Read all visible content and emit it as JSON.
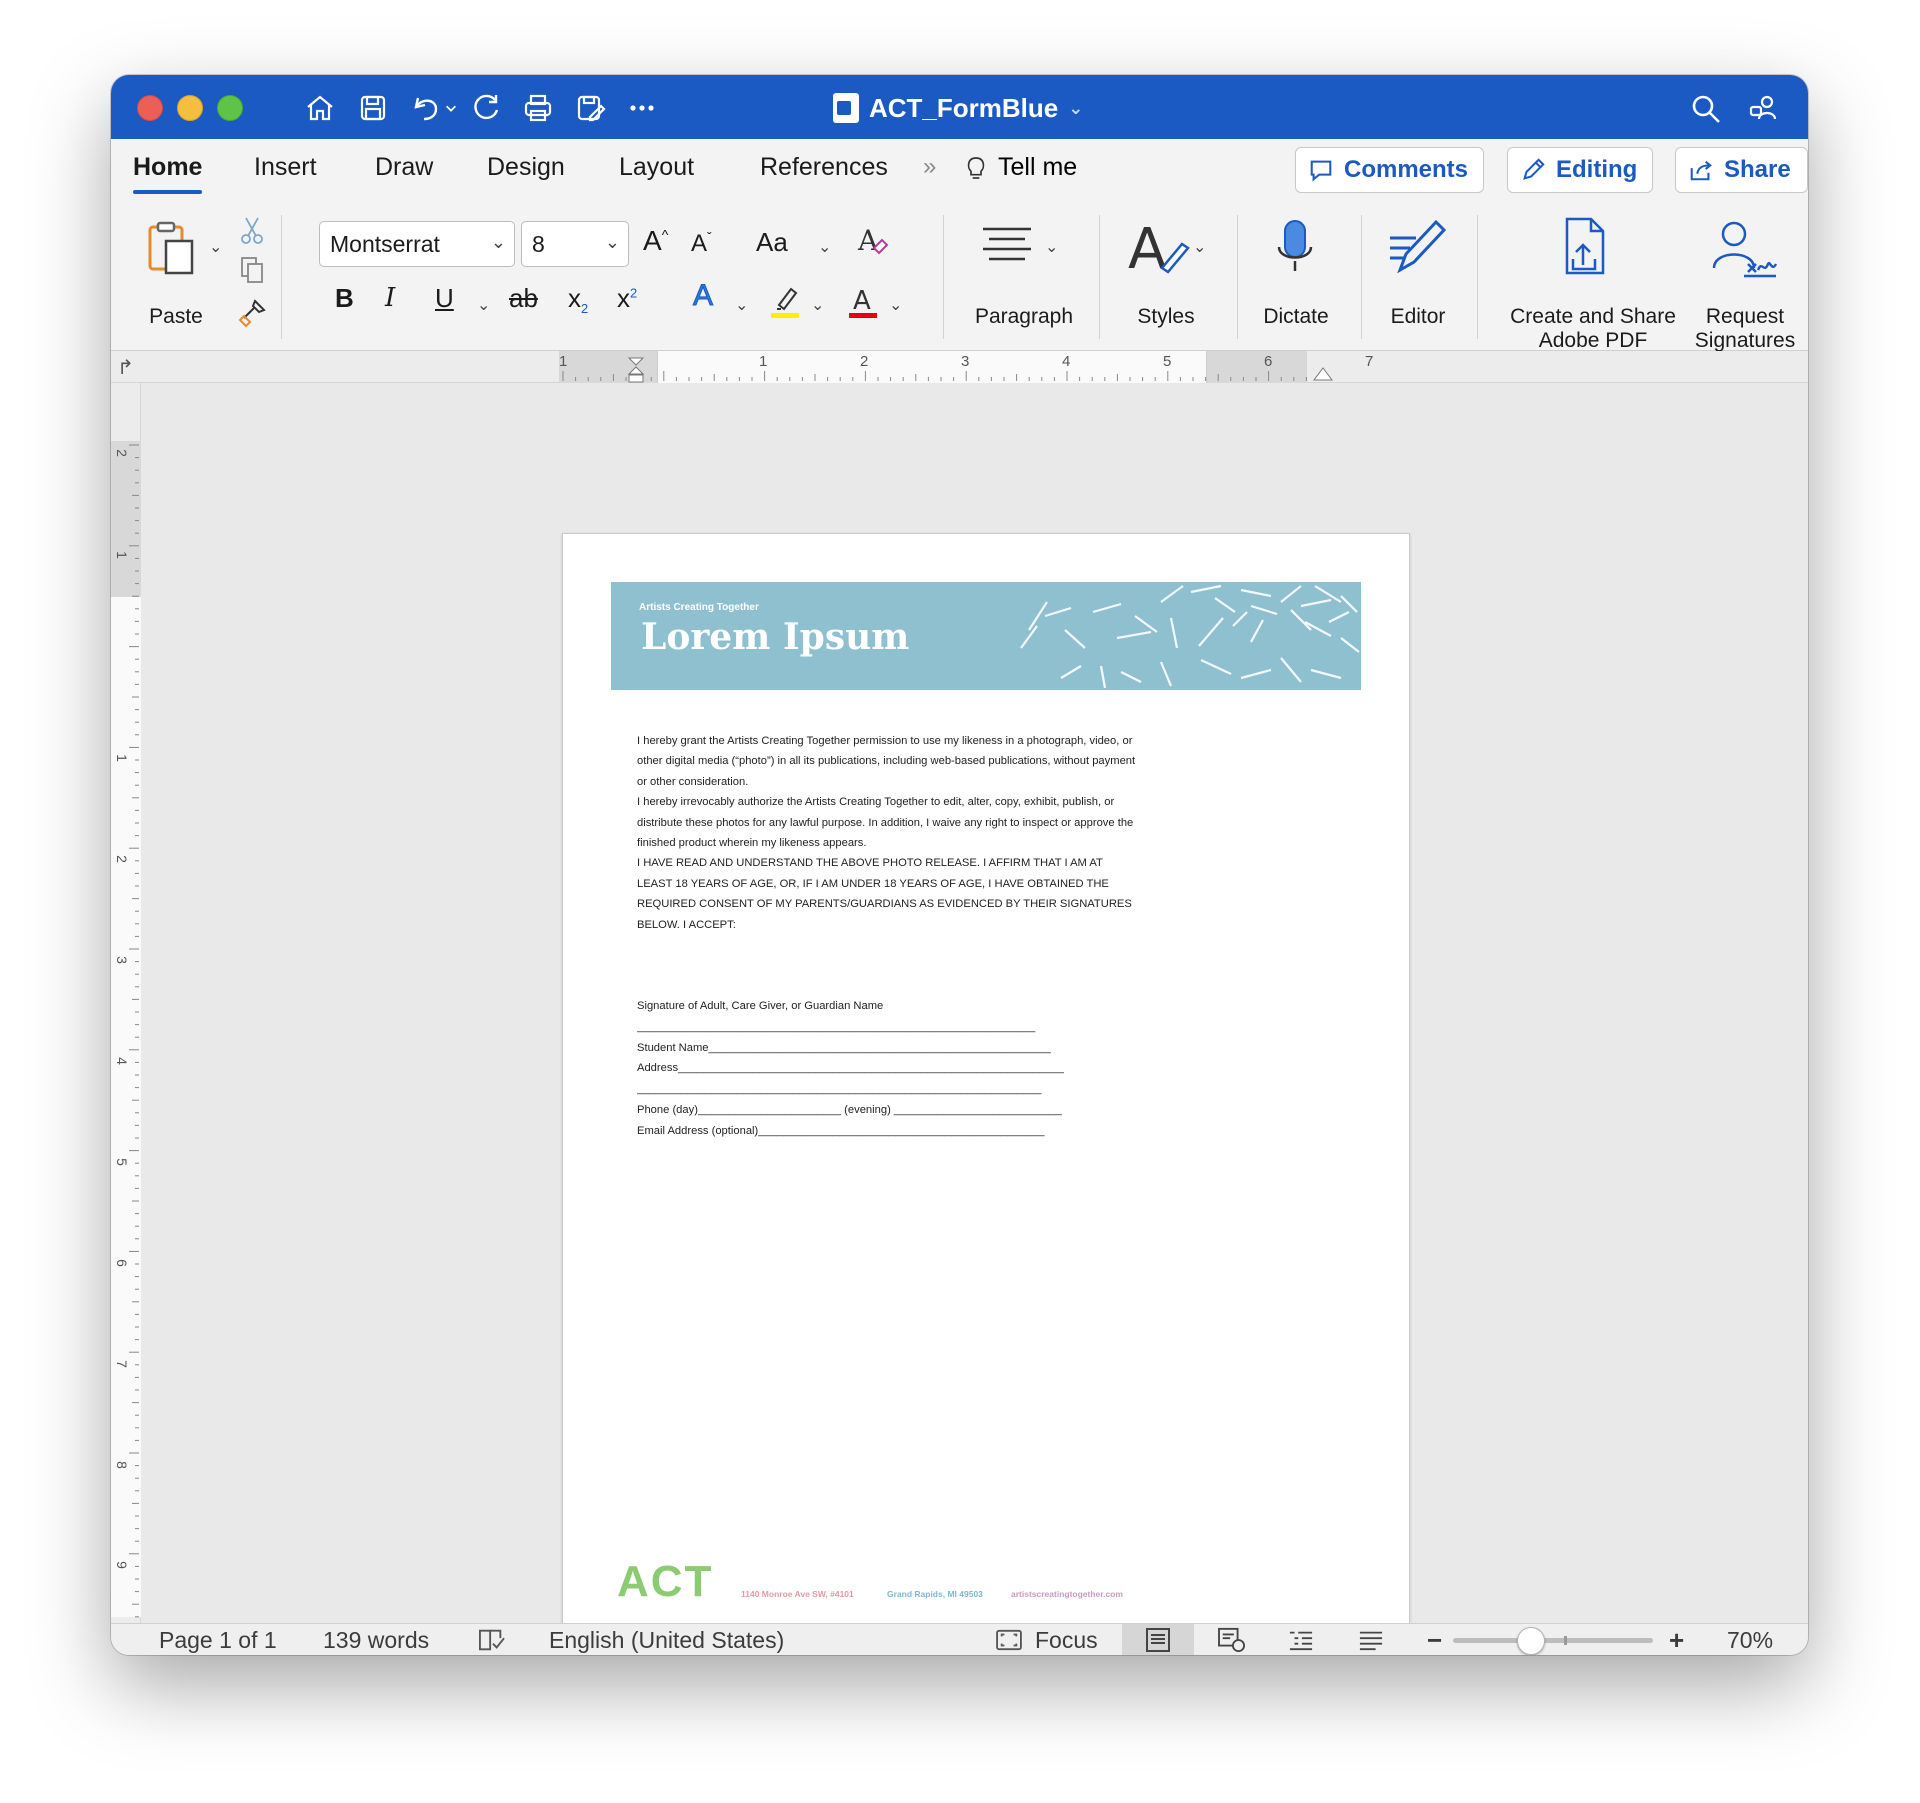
{
  "window": {
    "title": "ACT_FormBlue"
  },
  "tabs": {
    "items": [
      "Home",
      "Insert",
      "Draw",
      "Design",
      "Layout",
      "References"
    ],
    "tell_me": "Tell me",
    "comments": "Comments",
    "editing": "Editing",
    "share": "Share"
  },
  "ribbon": {
    "paste": "Paste",
    "font_name": "Montserrat",
    "font_size": "8",
    "case_label": "Aa",
    "paragraph": "Paragraph",
    "styles": "Styles",
    "dictate": "Dictate",
    "editor": "Editor",
    "create_pdf_line1": "Create and Share",
    "create_pdf_line2": "Adobe PDF",
    "request_line1": "Request",
    "request_line2": "Signatures",
    "colors": {
      "highlight": "#ffee00",
      "font_color": "#e8000b",
      "accent": "#1a5ac2"
    }
  },
  "ruler": {
    "h_numbers": [
      "1",
      "1",
      "2",
      "3",
      "4",
      "5",
      "6",
      "7"
    ],
    "v_numbers": [
      "2",
      "1",
      "1",
      "2",
      "3",
      "4",
      "5",
      "6",
      "7",
      "8",
      "9"
    ]
  },
  "document": {
    "banner_kicker": "Artists Creating Together",
    "banner_title": "Lorem Ipsum",
    "para1": "I hereby grant the Artists Creating Together permission to use my likeness in a photograph, video, or other digital media (“photo”) in all its publications, including web-based publications, without payment or other consideration.",
    "para2": "I hereby irrevocably authorize the Artists Creating Together to edit, alter, copy, exhibit, publish, or distribute these photos for any lawful purpose. In addition, I waive any right to inspect or approve the finished product wherein my likeness appears.",
    "para3": "I HAVE READ AND UNDERSTAND THE ABOVE PHOTO RELEASE. I AFFIRM THAT I AM AT LEAST 18 YEARS OF AGE, OR, IF I AM UNDER 18 YEARS OF AGE, I HAVE OBTAINED THE REQUIRED CONSENT OF MY PARENTS/GUARDIANS AS EVIDENCED BY THEIR SIGNATURES BELOW. I ACCEPT:",
    "sig_label": "Signature of Adult, Care Giver, or Guardian Name",
    "sig_line": "________________________________________________________________",
    "student": "Student Name_______________________________________________________",
    "address": "Address______________________________________________________________",
    "address_line2": "_________________________________________________________________",
    "phone": "Phone (day)_______________________ (evening) ___________________________",
    "email": "Email Address (optional)______________________________________________",
    "logo": "ACT",
    "footer_address": "1140 Monroe Ave SW, #4101",
    "footer_city": "Grand Rapids, MI 49503",
    "footer_web": "artistscreatingtogether.com",
    "footer_colors": {
      "address": "#e39aa5",
      "city": "#7fb8cc",
      "web": "#c79bc3",
      "logo": "#8ccb72",
      "banner": "#8fc0cf"
    }
  },
  "status": {
    "page": "Page 1 of 1",
    "words": "139 words",
    "language": "English (United States)",
    "focus": "Focus",
    "zoom": "70%",
    "zoom_value": 70
  }
}
